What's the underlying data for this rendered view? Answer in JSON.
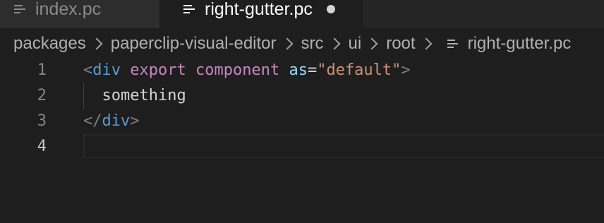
{
  "tabs": [
    {
      "label": "index.pc",
      "active": false,
      "icon": "lines-file-icon"
    },
    {
      "label": "right-gutter.pc",
      "active": true,
      "dirty": true,
      "icon": "lines-file-icon"
    }
  ],
  "breadcrumb": {
    "segments": [
      "packages",
      "paperclip-visual-editor",
      "src",
      "ui",
      "root"
    ],
    "file": "right-gutter.pc"
  },
  "editor": {
    "lines": [
      {
        "number": "1",
        "tokens": [
          {
            "text": "<",
            "kind": "punc"
          },
          {
            "text": "div",
            "kind": "tag"
          },
          {
            "text": " ",
            "kind": "text"
          },
          {
            "text": "export",
            "kind": "kw"
          },
          {
            "text": " ",
            "kind": "text"
          },
          {
            "text": "component",
            "kind": "kw"
          },
          {
            "text": " ",
            "kind": "text"
          },
          {
            "text": "as",
            "kind": "attr"
          },
          {
            "text": "=",
            "kind": "text"
          },
          {
            "text": "\"default\"",
            "kind": "str"
          },
          {
            "text": ">",
            "kind": "punc"
          }
        ]
      },
      {
        "number": "2",
        "tokens": [
          {
            "text": "  something",
            "kind": "text"
          }
        ]
      },
      {
        "number": "3",
        "tokens": [
          {
            "text": "</",
            "kind": "punc"
          },
          {
            "text": "div",
            "kind": "tag"
          },
          {
            "text": ">",
            "kind": "punc"
          }
        ]
      },
      {
        "number": "4",
        "tokens": []
      }
    ]
  },
  "colors": {
    "background": "#1e1e1e",
    "tab_inactive": "#2d2d2d",
    "tag": "#569cd6",
    "keyword": "#c586c0",
    "attribute": "#9cdcfe",
    "string": "#ce9178",
    "punctuation": "#808080",
    "text": "#d4d4d4"
  }
}
